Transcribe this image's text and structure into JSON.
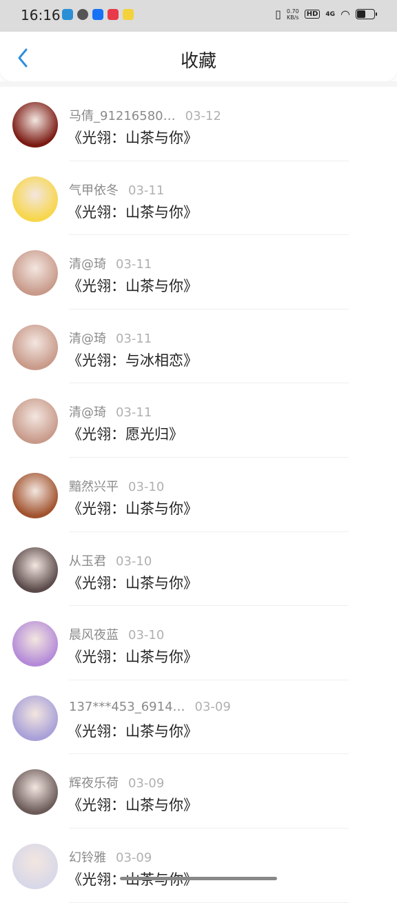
{
  "status_bar": {
    "time": "16:16",
    "speed_value": "0.70",
    "speed_unit": "KB/s",
    "hd": "HD",
    "network": "4G"
  },
  "header": {
    "title": "收藏"
  },
  "items": [
    {
      "name": "马倩_91216580…",
      "date": "03-12",
      "book": "《光翎：山茶与你》",
      "avatar_color": "#7a1a12"
    },
    {
      "name": "气甲依冬",
      "date": "03-11",
      "book": "《光翎：山茶与你》",
      "avatar_color": "#f7d64a"
    },
    {
      "name": "清@琦",
      "date": "03-11",
      "book": "《光翎：山茶与你》",
      "avatar_color": "#c89a8a"
    },
    {
      "name": "清@琦",
      "date": "03-11",
      "book": "《光翎：与冰相恋》",
      "avatar_color": "#c89a8a"
    },
    {
      "name": "清@琦",
      "date": "03-11",
      "book": "《光翎：愿光归》",
      "avatar_color": "#c89a8a"
    },
    {
      "name": "黯然兴平",
      "date": "03-10",
      "book": "《光翎：山茶与你》",
      "avatar_color": "#a0522d"
    },
    {
      "name": "从玉君",
      "date": "03-10",
      "book": "《光翎：山茶与你》",
      "avatar_color": "#5a4a4a"
    },
    {
      "name": "晨风夜蓝",
      "date": "03-10",
      "book": "《光翎：山茶与你》",
      "avatar_color": "#b48ad8"
    },
    {
      "name": "137***453_6914…",
      "date": "03-09",
      "book": "《光翎：山茶与你》",
      "avatar_color": "#a8a0d8"
    },
    {
      "name": "辉夜乐荷",
      "date": "03-09",
      "book": "《光翎：山茶与你》",
      "avatar_color": "#6a5a58"
    },
    {
      "name": "幻铃雅",
      "date": "03-09",
      "book": "《光翎：山茶与你》",
      "avatar_color": "#d8d8e8"
    }
  ]
}
